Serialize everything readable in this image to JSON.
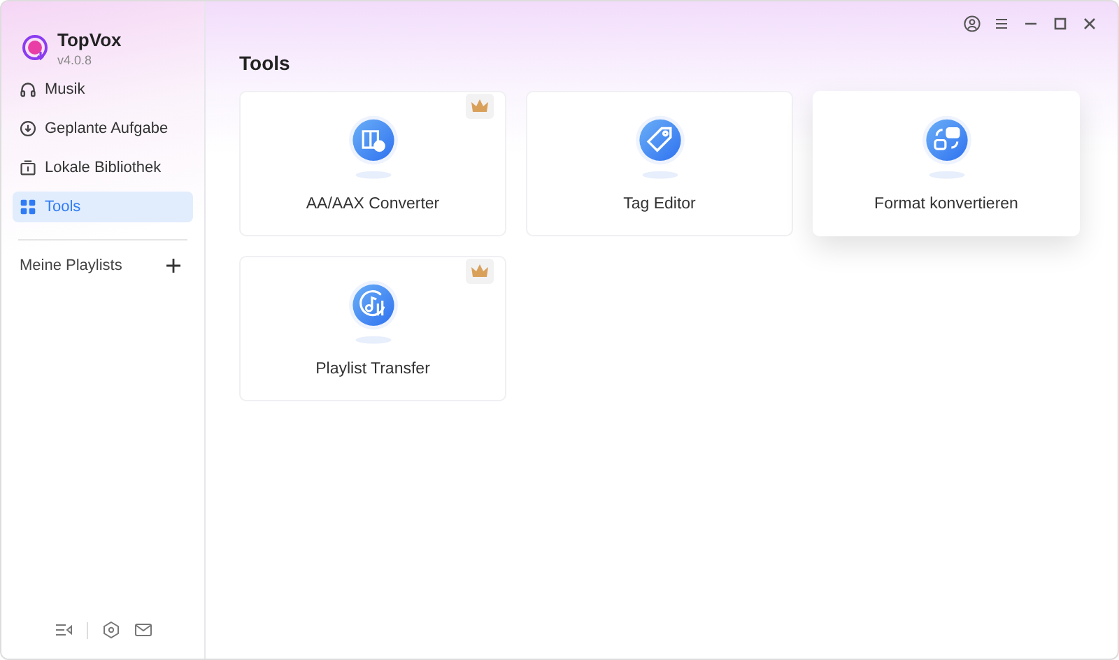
{
  "app": {
    "name": "TopVox",
    "version": "v4.0.8"
  },
  "sidebar": {
    "items": [
      {
        "label": "Musik",
        "kind": "headphones",
        "selected": false
      },
      {
        "label": "Geplante Aufgabe",
        "kind": "download",
        "selected": false
      },
      {
        "label": "Lokale Bibliothek",
        "kind": "library",
        "selected": false
      },
      {
        "label": "Tools",
        "kind": "grid",
        "selected": true
      }
    ],
    "playlists_label": "Meine Playlists"
  },
  "page_title": "Tools",
  "tools": [
    {
      "label": "AA/AAX Converter",
      "kind": "book",
      "premium": true,
      "highlighted": false
    },
    {
      "label": "Tag Editor",
      "kind": "tag",
      "premium": false,
      "highlighted": false
    },
    {
      "label": "Format konvertieren",
      "kind": "convert",
      "premium": false,
      "highlighted": true
    },
    {
      "label": "Playlist Transfer",
      "kind": "music",
      "premium": true,
      "highlighted": false
    }
  ]
}
